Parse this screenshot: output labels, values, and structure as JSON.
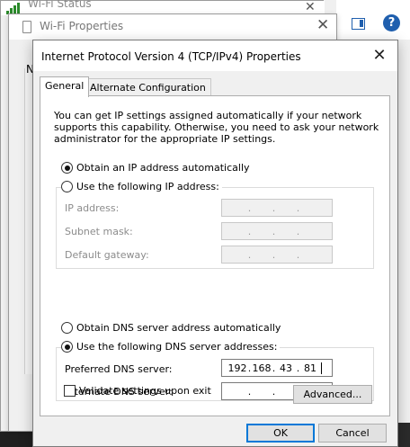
{
  "background": {
    "wifi_status_title": "Wi-Fi Status",
    "wifi_properties_title": "Wi-Fi Properties",
    "wifi_properties_partial_text": "N",
    "close_glyph": "✕",
    "help_glyph": "?"
  },
  "dialog": {
    "title": "Internet Protocol Version 4 (TCP/IPv4) Properties",
    "close_glyph": "✕",
    "tabs": [
      {
        "label": "General",
        "selected": true
      },
      {
        "label": "Alternate Configuration",
        "selected": false
      }
    ],
    "intro_text": "You can get IP settings assigned automatically if your network supports this capability. Otherwise, you need to ask your network administrator for the appropriate IP settings.",
    "ip_mode": {
      "auto_label": "Obtain an IP address automatically",
      "manual_label": "Use the following IP address:",
      "selected": "auto"
    },
    "ip_fields": {
      "ip_address_label": "IP address:",
      "subnet_mask_label": "Subnet mask:",
      "default_gateway_label": "Default gateway:",
      "ip_address_value": [
        "",
        "",
        "",
        ""
      ],
      "subnet_mask_value": [
        "",
        "",
        "",
        ""
      ],
      "default_gateway_value": [
        "",
        "",
        "",
        ""
      ]
    },
    "dns_mode": {
      "auto_label": "Obtain DNS server address automatically",
      "manual_label": "Use the following DNS server addresses:",
      "selected": "manual"
    },
    "dns_fields": {
      "preferred_label": "Preferred DNS server:",
      "alternate_label": "Alternate DNS server:",
      "preferred_value": [
        "192",
        "168",
        "43",
        "81"
      ],
      "alternate_value": [
        "",
        "",
        "",
        ""
      ]
    },
    "validate_label": "Validate settings upon exit",
    "validate_checked": false,
    "advanced_button": "Advanced...",
    "ok_button": "OK",
    "cancel_button": "Cancel",
    "dot": "."
  }
}
